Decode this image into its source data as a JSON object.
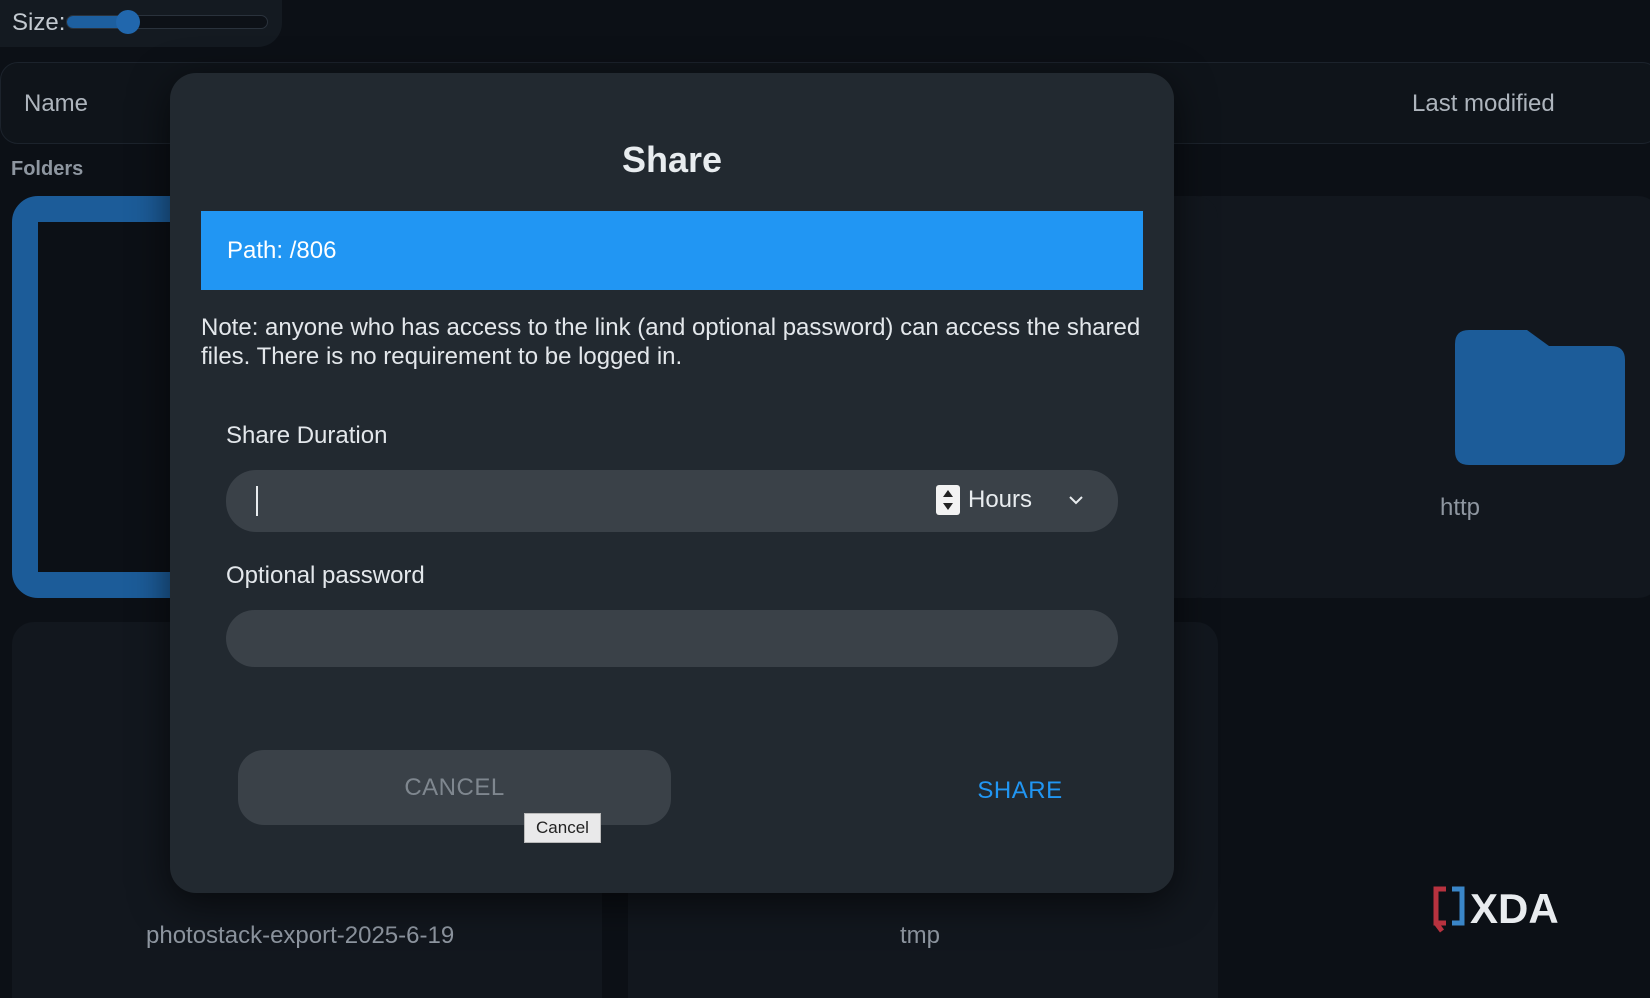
{
  "toolbar": {
    "size_label": "Size:",
    "size_value_fraction": 0.32
  },
  "columns": {
    "name": "Name",
    "last_modified": "Last modified"
  },
  "sections": {
    "folders": "Folders"
  },
  "folders": [
    {
      "name": "http"
    },
    {
      "name": "photostack-export-2025-6-19"
    },
    {
      "name": "tmp"
    }
  ],
  "dialog": {
    "title": "Share",
    "path": "Path: /806",
    "note": "Note: anyone who has access to the link (and optional password) can access the shared files. There is no requirement to be logged in.",
    "duration_label": "Share Duration",
    "duration_value": "",
    "duration_unit": "Hours",
    "password_label": "Optional password",
    "password_value": "",
    "cancel_label": "CANCEL",
    "share_label": "SHARE",
    "tooltip": "Cancel"
  },
  "watermark": {
    "text": "XDA"
  },
  "colors": {
    "accent": "#2196f3",
    "background": "#0c1016",
    "dialog": "#222930",
    "folder": "#1c5c99"
  }
}
